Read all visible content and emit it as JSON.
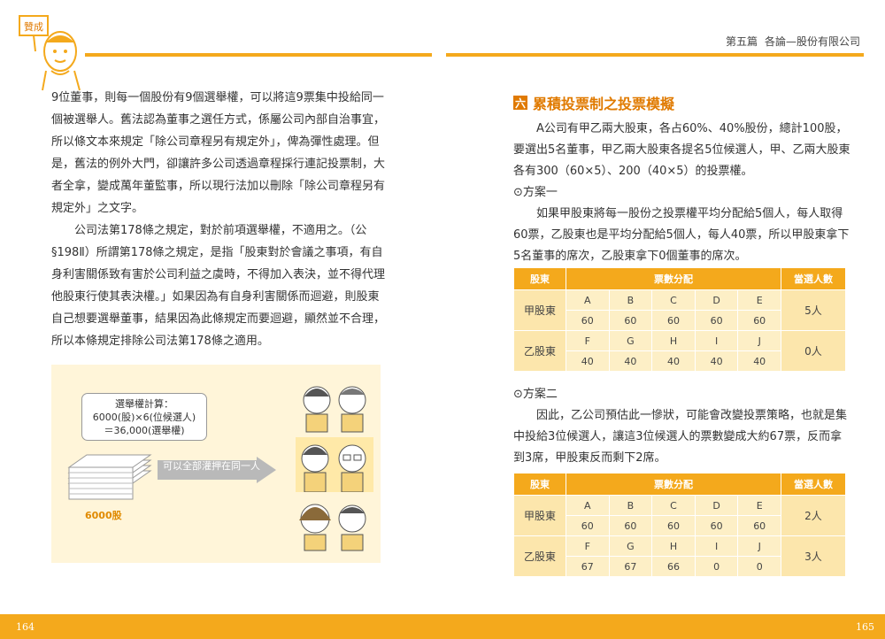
{
  "header": {
    "chapter": "第五篇",
    "title": "各論—股份有限公司"
  },
  "mascot": {
    "sign": "贊成"
  },
  "left": {
    "paragraphs": [
      "9位董事，則每一個股份有9個選舉權，可以將這9票集中投給同一個被選舉人。舊法認為董事之選任方式，係屬公司內部自治事宜，所以條文本來規定「除公司章程另有規定外」，俾為彈性處理。但是，舊法的例外大門，卻讓許多公司透過章程採行連記投票制，大者全拿，變成萬年董監事，所以現行法加以刪除「除公司章程另有規定外」之文字。",
      "公司法第178條之規定，對於前項選舉權，不適用之。（公§198Ⅱ）所謂第178條之規定，是指「股東對於會議之事項，有自身利害關係致有害於公司利益之虞時，不得加入表決，並不得代理他股東行使其表決權。」如果因為有自身利害關係而迴避，則股東自己想要選舉董事，結果因為此條規定而要迴避，顯然並不合理，所以本條規定排除公司法第178條之適用。"
    ]
  },
  "illustration": {
    "calc_lines": [
      "選舉權計算：",
      "6000(股)×6(位候選人)",
      "＝36,000(選舉權)"
    ],
    "arrow_text": "可以全部灌押在同一人",
    "count_label": "6000股"
  },
  "right": {
    "badge": "六",
    "title": "累積投票制之投票模擬",
    "intro": "A公司有甲乙兩大股東，各占60%、40%股份，總計100股，要選出5名董事，甲乙兩大股東各提名5位候選人，甲、乙兩大股東各有300（60×5）、200（40×5）的投票權。",
    "plan1_label": "⊙方案一",
    "plan1_text": "如果甲股東將每一股份之投票權平均分配給5個人，每人取得60票，乙股東也是平均分配給5個人，每人40票，所以甲股東拿下5名董事的席次，乙股東拿下0個董事的席次。",
    "plan2_label": "⊙方案二",
    "plan2_text": "因此，乙公司預估此一慘狀，可能會改變投票策略，也就是集中投給3位候選人，讓這3位候選人的票數變成大約67票，反而拿到3席，甲股東反而剩下2席。"
  },
  "table_headers": {
    "holder": "股東",
    "dist": "票數分配",
    "elected": "當選人數"
  },
  "table1": {
    "rows": [
      {
        "name": "甲股東",
        "cands": [
          "A",
          "B",
          "C",
          "D",
          "E"
        ],
        "votes": [
          "60",
          "60",
          "60",
          "60",
          "60"
        ],
        "elected": "5人"
      },
      {
        "name": "乙股東",
        "cands": [
          "F",
          "G",
          "H",
          "I",
          "J"
        ],
        "votes": [
          "40",
          "40",
          "40",
          "40",
          "40"
        ],
        "elected": "0人"
      }
    ]
  },
  "table2": {
    "rows": [
      {
        "name": "甲股東",
        "cands": [
          "A",
          "B",
          "C",
          "D",
          "E"
        ],
        "votes": [
          "60",
          "60",
          "60",
          "60",
          "60"
        ],
        "elected": "2人"
      },
      {
        "name": "乙股東",
        "cands": [
          "F",
          "G",
          "H",
          "I",
          "J"
        ],
        "votes": [
          "67",
          "67",
          "66",
          "0",
          "0"
        ],
        "elected": "3人"
      }
    ]
  },
  "footer": {
    "left_page": "164",
    "right_page": "165"
  },
  "colors": {
    "accent": "#f4a91c",
    "title": "#e07a00",
    "cell": "#fdefc6"
  }
}
